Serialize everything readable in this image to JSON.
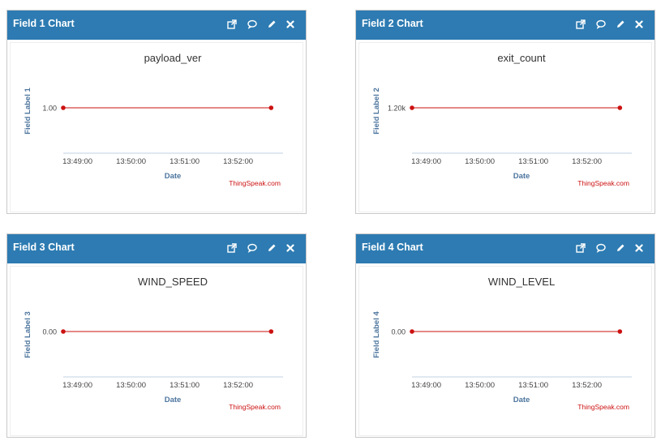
{
  "panels": [
    {
      "title": "Field 1 Chart",
      "tools": [
        "external-link-icon",
        "comment-icon",
        "pencil-icon",
        "close-icon"
      ],
      "chart_data": {
        "type": "line",
        "title": "payload_ver",
        "xlabel": "Date",
        "ylabel": "Field Label 1",
        "x_ticks": [
          "13:49:00",
          "13:50:00",
          "13:51:00",
          "13:52:00"
        ],
        "y_ticks": [
          "1.00"
        ],
        "series": [
          {
            "x": [
              "13:48:44",
              "13:52:37"
            ],
            "y": [
              1.0,
              1.0
            ]
          }
        ],
        "credit": "ThingSpeak.com",
        "color": "#cc1111"
      }
    },
    {
      "title": "Field 2 Chart",
      "tools": [
        "external-link-icon",
        "comment-icon",
        "pencil-icon",
        "close-icon"
      ],
      "chart_data": {
        "type": "line",
        "title": "exit_count",
        "xlabel": "Date",
        "ylabel": "Field Label 2",
        "x_ticks": [
          "13:49:00",
          "13:50:00",
          "13:51:00",
          "13:52:00"
        ],
        "y_ticks": [
          "1.20k"
        ],
        "series": [
          {
            "x": [
              "13:48:44",
              "13:52:37"
            ],
            "y": [
              1200,
              1200
            ]
          }
        ],
        "credit": "ThingSpeak.com",
        "color": "#cc1111"
      }
    },
    {
      "title": "Field 3 Chart",
      "tools": [
        "external-link-icon",
        "comment-icon",
        "pencil-icon",
        "close-icon"
      ],
      "chart_data": {
        "type": "line",
        "title": "WIND_SPEED",
        "xlabel": "Date",
        "ylabel": "Field Label 3",
        "x_ticks": [
          "13:49:00",
          "13:50:00",
          "13:51:00",
          "13:52:00"
        ],
        "y_ticks": [
          "0.00"
        ],
        "series": [
          {
            "x": [
              "13:48:44",
              "13:52:37"
            ],
            "y": [
              0.0,
              0.0
            ]
          }
        ],
        "credit": "ThingSpeak.com",
        "color": "#cc1111"
      }
    },
    {
      "title": "Field 4 Chart",
      "tools": [
        "external-link-icon",
        "comment-icon",
        "pencil-icon",
        "close-icon"
      ],
      "chart_data": {
        "type": "line",
        "title": "WIND_LEVEL",
        "xlabel": "Date",
        "ylabel": "Field Label 4",
        "x_ticks": [
          "13:49:00",
          "13:50:00",
          "13:51:00",
          "13:52:00"
        ],
        "y_ticks": [
          "0.00"
        ],
        "series": [
          {
            "x": [
              "13:48:44",
              "13:52:37"
            ],
            "y": [
              0.0,
              0.0
            ]
          }
        ],
        "credit": "ThingSpeak.com",
        "color": "#cc1111"
      }
    }
  ]
}
